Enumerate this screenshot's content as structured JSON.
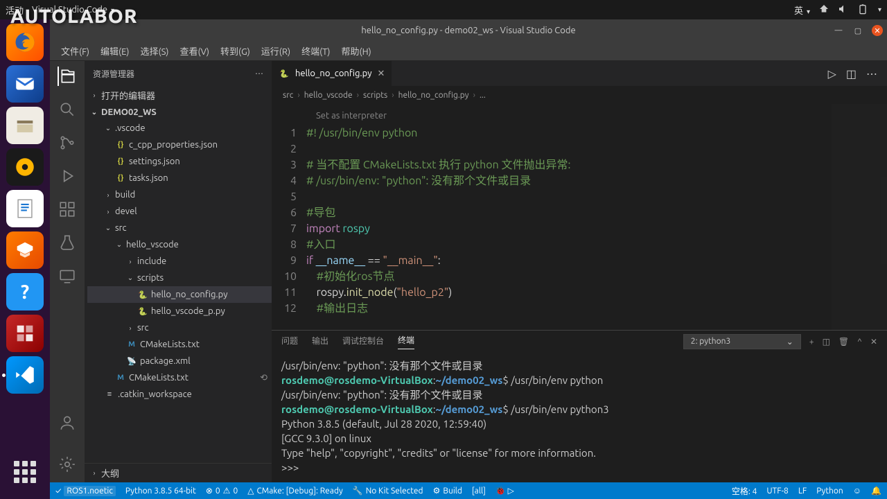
{
  "topbar": {
    "activities": "活动",
    "app_menu": "Visual Studio Code",
    "lang": "英"
  },
  "titlebar": {
    "title": "hello_no_config.py - demo02_ws - Visual Studio Code"
  },
  "menubar": {
    "items": [
      "文件(F)",
      "编辑(E)",
      "选择(S)",
      "查看(V)",
      "转到(G)",
      "运行(R)",
      "终端(T)",
      "帮助(H)"
    ]
  },
  "sidebar": {
    "title": "资源管理器",
    "open_editors": "打开的编辑器",
    "workspace": "DEMO02_WS",
    "outline": "大纲",
    "tree": {
      "vscode": ".vscode",
      "c_cpp": "c_cpp_properties.json",
      "settings": "settings.json",
      "tasks": "tasks.json",
      "build": "build",
      "devel": "devel",
      "src": "src",
      "hello_vscode": "hello_vscode",
      "include": "include",
      "scripts": "scripts",
      "hello_no_config": "hello_no_config.py",
      "hello_vscode_p": "hello_vscode_p.py",
      "src2": "src",
      "cmake1": "CMakeLists.txt",
      "package": "package.xml",
      "cmake2": "CMakeLists.txt",
      "catkin": ".catkin_workspace"
    }
  },
  "tab": {
    "name": "hello_no_config.py"
  },
  "breadcrumb": {
    "parts": [
      "src",
      "hello_vscode",
      "scripts",
      "hello_no_config.py",
      "..."
    ]
  },
  "editor": {
    "interpreter_hint": "Set as interpreter",
    "lines": [
      {
        "n": "1",
        "seg": [
          {
            "c": "c-green",
            "t": "#! /usr/bin/env python"
          }
        ]
      },
      {
        "n": "2",
        "seg": [
          {
            "c": "c-white",
            "t": ""
          }
        ]
      },
      {
        "n": "3",
        "seg": [
          {
            "c": "c-green",
            "t": "# 当不配置 CMakeLists.txt 执行 python 文件抛出异常:"
          }
        ]
      },
      {
        "n": "4",
        "seg": [
          {
            "c": "c-green",
            "t": "# /usr/bin/env: \"python\": 没有那个文件或目录"
          }
        ]
      },
      {
        "n": "5",
        "seg": [
          {
            "c": "c-white",
            "t": ""
          }
        ]
      },
      {
        "n": "6",
        "seg": [
          {
            "c": "c-green",
            "t": "#导包"
          }
        ]
      },
      {
        "n": "7",
        "seg": [
          {
            "c": "c-purple",
            "t": "import"
          },
          {
            "c": "c-white",
            "t": " "
          },
          {
            "c": "c-cyan",
            "t": "rospy"
          }
        ]
      },
      {
        "n": "8",
        "seg": [
          {
            "c": "c-green",
            "t": "#入口"
          }
        ]
      },
      {
        "n": "9",
        "seg": [
          {
            "c": "c-purple",
            "t": "if"
          },
          {
            "c": "c-white",
            "t": " "
          },
          {
            "c": "c-ltblue",
            "t": "__name__"
          },
          {
            "c": "c-white",
            "t": " == "
          },
          {
            "c": "c-orange",
            "t": "\"__main__\""
          },
          {
            "c": "c-white",
            "t": ":"
          }
        ]
      },
      {
        "n": "10",
        "seg": [
          {
            "c": "c-green",
            "t": "    #初始化ros节点"
          }
        ]
      },
      {
        "n": "11",
        "seg": [
          {
            "c": "c-white",
            "t": "    rospy."
          },
          {
            "c": "c-yellow",
            "t": "init_node"
          },
          {
            "c": "c-white",
            "t": "("
          },
          {
            "c": "c-orange",
            "t": "\"hello_p2\""
          },
          {
            "c": "c-white",
            "t": ")"
          }
        ]
      },
      {
        "n": "12",
        "seg": [
          {
            "c": "c-green",
            "t": "    #输出日志"
          }
        ]
      }
    ]
  },
  "panel": {
    "tabs": {
      "problems": "问题",
      "output": "输出",
      "debug": "调试控制台",
      "terminal": "终端"
    },
    "term_select": "2: python3",
    "terminal_lines": [
      {
        "seg": [
          {
            "c": "",
            "t": "/usr/bin/env: \"python\": 没有那个文件或目录"
          }
        ]
      },
      {
        "seg": [
          {
            "c": "term-cyan",
            "t": "rosdemo@rosdemo-VirtualBox"
          },
          {
            "c": "",
            "t": ":"
          },
          {
            "c": "term-blue",
            "t": "~/demo02_ws"
          },
          {
            "c": "",
            "t": "$ /usr/bin/env python"
          }
        ]
      },
      {
        "seg": [
          {
            "c": "",
            "t": "/usr/bin/env: \"python\": 没有那个文件或目录"
          }
        ]
      },
      {
        "seg": [
          {
            "c": "term-cyan",
            "t": "rosdemo@rosdemo-VirtualBox"
          },
          {
            "c": "",
            "t": ":"
          },
          {
            "c": "term-blue",
            "t": "~/demo02_ws"
          },
          {
            "c": "",
            "t": "$ /usr/bin/env python3"
          }
        ]
      },
      {
        "seg": [
          {
            "c": "",
            "t": "Python 3.8.5 (default, Jul 28 2020, 12:59:40)"
          }
        ]
      },
      {
        "seg": [
          {
            "c": "",
            "t": "[GCC 9.3.0] on linux"
          }
        ]
      },
      {
        "seg": [
          {
            "c": "",
            "t": "Type \"help\", \"copyright\", \"credits\" or \"license\" for more information."
          }
        ]
      },
      {
        "seg": [
          {
            "c": "",
            "t": ">>> "
          }
        ]
      }
    ]
  },
  "statusbar": {
    "ros": "ROS1.noetic",
    "python": "Python 3.8.5 64-bit",
    "errors": "0",
    "warnings": "0",
    "cmake": "CMake: [Debug]: Ready",
    "nokit": "No Kit Selected",
    "build": "Build",
    "all": "[all]",
    "spaces": "空格: 4",
    "encoding": "UTF-8",
    "eol": "LF",
    "lang": "Python"
  }
}
